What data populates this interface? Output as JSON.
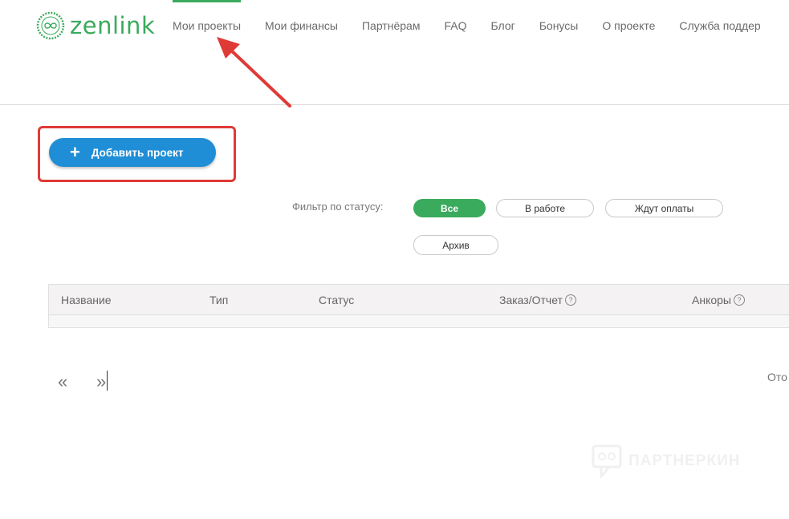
{
  "brand": {
    "name": "zenlink",
    "color": "#3aaa5c"
  },
  "nav": [
    {
      "label": "Мои проекты",
      "active": true
    },
    {
      "label": "Мои финансы"
    },
    {
      "label": "Партнёрам"
    },
    {
      "label": "FAQ"
    },
    {
      "label": "Блог"
    },
    {
      "label": "Бонусы"
    },
    {
      "label": "О проекте"
    },
    {
      "label": "Служба поддер"
    }
  ],
  "add_button": {
    "label": "Добавить проект",
    "color": "#1f8ed6"
  },
  "filter": {
    "label": "Фильтр по статусу:",
    "options": [
      "Все",
      "В работе",
      "Ждут оплаты",
      "Архив"
    ],
    "selected": "Все"
  },
  "table": {
    "columns": [
      "Название",
      "Тип",
      "Статус",
      "Заказ/Отчет",
      "Анкоры"
    ],
    "help_icon": "?"
  },
  "pager": {
    "prev": "«",
    "next": "»"
  },
  "side_text": "Ото",
  "watermark": "ПАРТНЕРКИН",
  "annotation_color": "#e03a37"
}
